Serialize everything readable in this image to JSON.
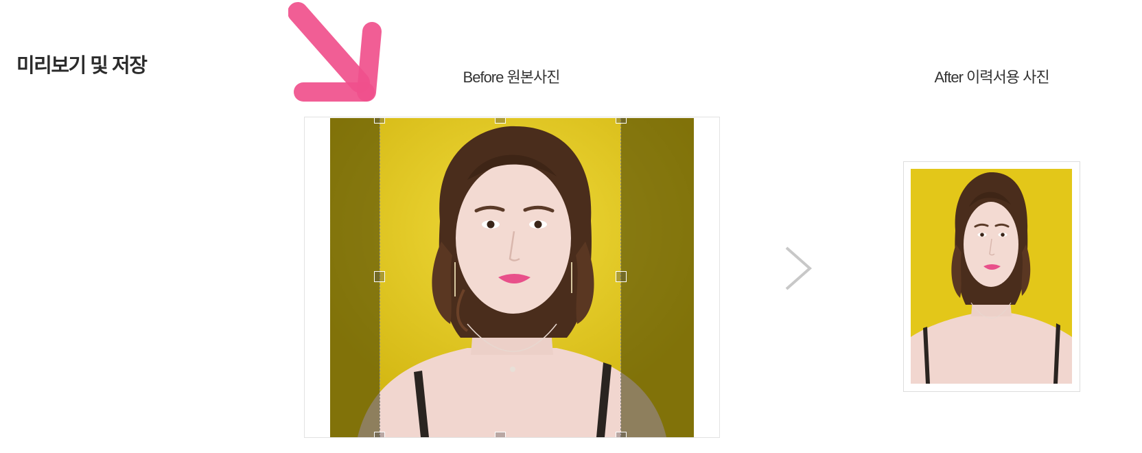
{
  "section": {
    "title": "미리보기 및 저장"
  },
  "before": {
    "label": "Before 원본사진"
  },
  "after": {
    "label": "After 이력서용 사진"
  },
  "icons": {
    "next": "chevron-right-icon",
    "annotation": "pink-arrow-icon"
  },
  "colors": {
    "background_yellow": "#e2c61c",
    "dimmed_olive": "#6b6520",
    "annotation_pink": "#f0508c",
    "chevron_gray": "#c8c8c8"
  }
}
